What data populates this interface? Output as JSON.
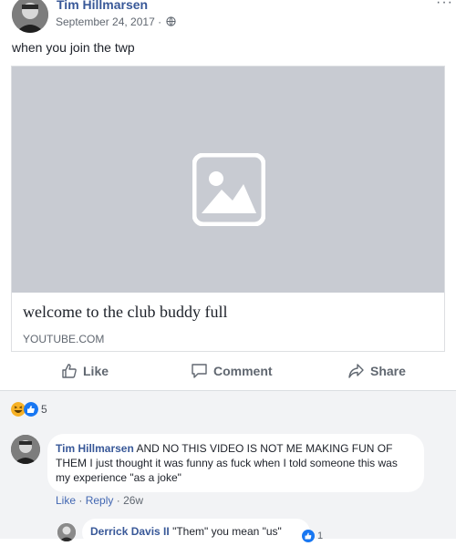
{
  "post": {
    "author": "Tim Hillmarsen",
    "date": "September 24, 2017 ·",
    "text": "when you join the twp",
    "link": {
      "title": "welcome to the club buddy full",
      "domain": "YOUTUBE.COM"
    },
    "more_label": "···"
  },
  "actions": {
    "like": "Like",
    "comment": "Comment",
    "share": "Share"
  },
  "reactions": {
    "count": "5",
    "types": [
      "haha",
      "like"
    ]
  },
  "comments": [
    {
      "author": "Tim Hillmarsen",
      "text": "AND NO THIS VIDEO IS NOT ME MAKING FUN OF THEM I just thought it was funny as fuck when I told someone this was my experience \"as a joke\"",
      "like_label": "Like",
      "reply_label": "Reply",
      "age": "26w"
    }
  ],
  "reply": {
    "author": "Derrick Davis II",
    "text": "\"Them\" you mean \"us\"",
    "reaction_count": "1"
  },
  "colors": {
    "link_blue": "#385898",
    "action_blue": "#4267b2",
    "placeholder_gray": "#c8cbd2",
    "comment_bg": "#f2f3f5"
  }
}
